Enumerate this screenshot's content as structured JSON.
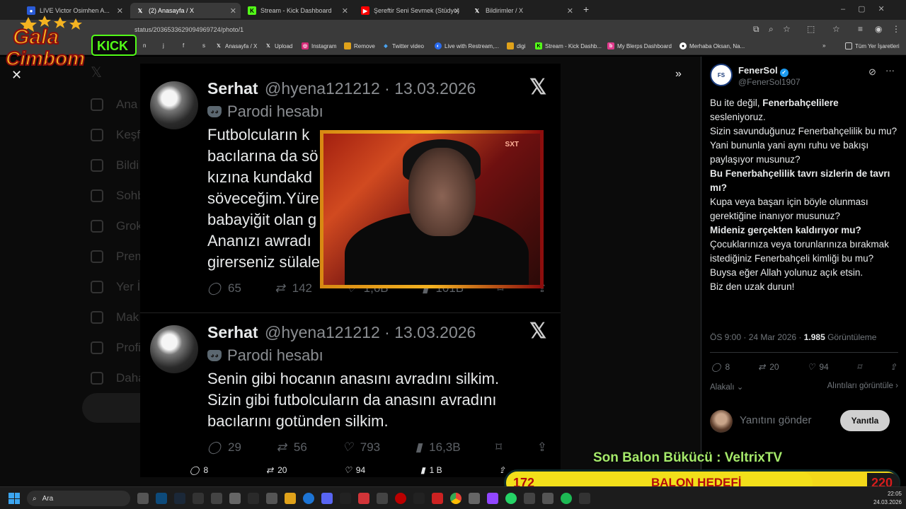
{
  "browser": {
    "tabs": [
      {
        "label": "LIVE Victor Osimhen A...",
        "favicon": "kick-icon",
        "active": false
      },
      {
        "label": "(2) Anasayfa / X",
        "favicon": "x-icon",
        "active": true
      },
      {
        "label": "Stream - Kick Dashboard",
        "favicon": "kick-icon",
        "active": false
      },
      {
        "label": "Şereftir Seni Sevmek (Stüdyo)",
        "favicon": "youtube-icon",
        "active": false
      },
      {
        "label": "Bildirimler / X",
        "favicon": "x-icon",
        "active": false
      }
    ],
    "url": "status/2036533629094969724/photo/1",
    "bookmarks": [
      {
        "label": "Anasayfa / X",
        "icon": "x-icon"
      },
      {
        "label": "Upload",
        "icon": "x-icon"
      },
      {
        "label": "Instagram",
        "icon": "instagram-icon"
      },
      {
        "label": "Remove",
        "icon": "folder-icon"
      },
      {
        "label": "Twitter video",
        "icon": "diamond-icon"
      },
      {
        "label": "Live with Restream,...",
        "icon": "restream-icon"
      },
      {
        "label": "digi",
        "icon": "folder-icon"
      },
      {
        "label": "Stream - Kick Dashb...",
        "icon": "kick-icon"
      },
      {
        "label": "My Blerps Dashboard",
        "icon": "blerp-icon"
      },
      {
        "label": "Merhaba Oksan, Na...",
        "icon": "github-icon"
      }
    ],
    "all_bookmarks": "Tüm Yer İşaretleri",
    "bookmark_short": [
      "n",
      "j",
      "f",
      "s"
    ]
  },
  "logo": {
    "line1": "Gala",
    "line2": "Cimbom",
    "badge": "KICK"
  },
  "sidenav": [
    "Ana",
    "Keşf",
    "Bildi",
    "Sohb",
    "Grok",
    "Prem",
    "Yer İ",
    "Mak",
    "Profi",
    "Daha"
  ],
  "photo_tweets": [
    {
      "name": "Serhat",
      "handle": "@hyena121212 · 13.03.2026",
      "parody": "Parodi hesabı",
      "body_lines": [
        "Futbolcuların k",
        "bacılarına da sö",
        "kızına kundakd",
        "söveceğim.Yüre",
        "babayiğit olan g",
        "Ananızı awradı",
        "girerseniz sülale"
      ],
      "stats": {
        "replies": "65",
        "retweets": "142",
        "likes": "1,6B",
        "views": "101B"
      }
    },
    {
      "name": "Serhat",
      "handle": "@hyena121212 · 13.03.2026",
      "parody": "Parodi hesabı",
      "body_lines": [
        "Senin gibi hocanın anasını avradını silkim.",
        "Sizin gibi futbolcuların da anasını avradını",
        "bacılarını gotünden silkim."
      ],
      "stats": {
        "replies": "29",
        "retweets": "56",
        "likes": "793",
        "views": "16,3B"
      }
    }
  ],
  "webcam": {
    "brand": "SXT"
  },
  "right_tweet": {
    "name": "FenerSol",
    "handle": "@FenerSol1907",
    "body": [
      {
        "t": "Bu ite değil, ",
        "b": false
      },
      {
        "t": "Fenerbahçelilere",
        "b": true
      },
      {
        "t": " sesleniyoruz.",
        "b": false,
        "br": true
      },
      {
        "t": "Sizin savunduğunuz Fenerbahçelilik bu mu?",
        "b": false,
        "br": true
      },
      {
        "t": "Yani bununla yani aynı ruhu ve bakışı paylaşıyor musunuz?",
        "b": false,
        "br": true
      },
      {
        "t": "Bu Fenerbahçelilik tavrı sizlerin de tavrı mı?",
        "b": true,
        "br": true
      },
      {
        "t": "Kupa veya başarı için böyle olunması gerektiğine inanıyor musunuz?",
        "b": false,
        "br": true
      },
      {
        "t": "Mideniz gerçekten kaldırıyor mu?",
        "b": true,
        "br": true
      },
      {
        "t": "Çocuklarınıza veya torunlarınıza bırakmak istediğiniz Fenerbahçeli kimliği bu mu?",
        "b": false,
        "br": true
      },
      {
        "t": "Buysa eğer Allah yolunuz açık etsin.",
        "b": false,
        "br": true
      },
      {
        "t": "Biz den uzak durun!",
        "b": false,
        "br": true
      }
    ],
    "meta_time": "ÖS 9:00 · 24 Mar 2026 · ",
    "meta_views": "1.985",
    "meta_views_label": " Görüntüleme",
    "replies": "8",
    "retweets": "20",
    "likes": "94",
    "quotes_link": "Alakalı",
    "quotes_view": "Alıntıları görüntüle",
    "reply_placeholder": "Yanıtını gönder",
    "reply_button": "Yanıtla"
  },
  "bottom_bar": {
    "replies": "8",
    "retweets": "20",
    "likes": "94",
    "views": "1 B"
  },
  "stream_overlay": {
    "son_balon": "Son Balon Bükücü : VeltrixTV",
    "balon_current": "172",
    "balon_title": "BALON HEDEFİ",
    "balon_goal": "220",
    "balon_progress": 0.782
  },
  "taskbar": {
    "search": "Ara",
    "time": "22:05",
    "date": "24.03.2026"
  },
  "colors": {
    "accent": "#1d9bf0",
    "gala_yellow": "#f4b321",
    "gala_red": "#b40c0c",
    "balon_green": "#a5e96a"
  }
}
